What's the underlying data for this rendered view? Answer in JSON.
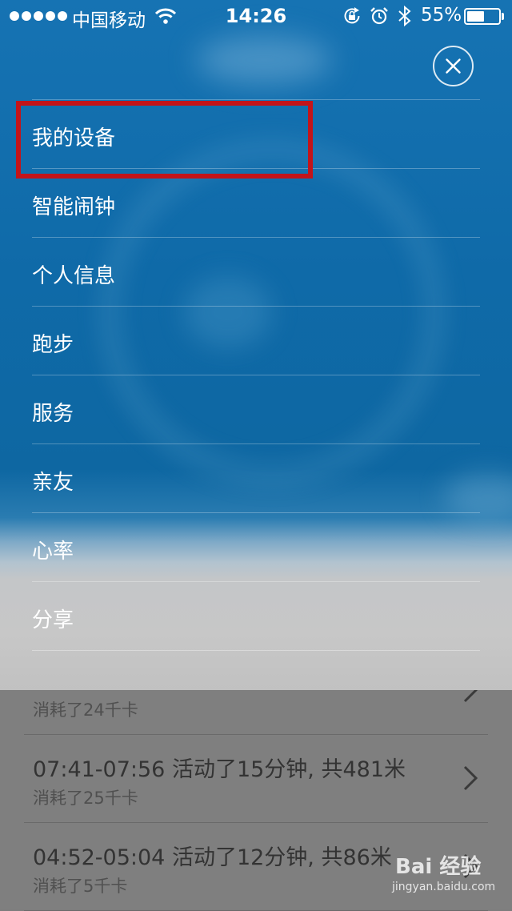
{
  "status_bar": {
    "carrier": "中国移动",
    "time": "14:26",
    "battery_percent_label": "55%",
    "battery_level": 0.55,
    "icons": [
      "signal-dots-icon",
      "wifi-icon",
      "rotation-lock-icon",
      "alarm-icon",
      "bluetooth-icon",
      "battery-icon"
    ]
  },
  "menu": {
    "close_icon": "close-icon",
    "items": [
      {
        "label": "我的设备"
      },
      {
        "label": "智能闹钟"
      },
      {
        "label": "个人信息"
      },
      {
        "label": "跑步"
      },
      {
        "label": "服务"
      },
      {
        "label": "亲友"
      },
      {
        "label": "心率"
      },
      {
        "label": "分享"
      }
    ],
    "highlighted_item": "我的设备",
    "highlight_color": "#c3141a"
  },
  "activity_list": {
    "rows": [
      {
        "main": "",
        "sub": "消耗了24千卡"
      },
      {
        "main": "07:41-07:56 活动了15分钟, 共481米",
        "sub": "消耗了25千卡"
      },
      {
        "main": "04:52-05:04 活动了12分钟, 共86米",
        "sub": "消耗了5千卡"
      }
    ]
  },
  "watermark": {
    "logo": "Bai 经验",
    "url": "jingyan.baidu.com"
  },
  "colors": {
    "menu_blue": "#0f6aa8",
    "overlay_gray": "#7f7f7f"
  }
}
